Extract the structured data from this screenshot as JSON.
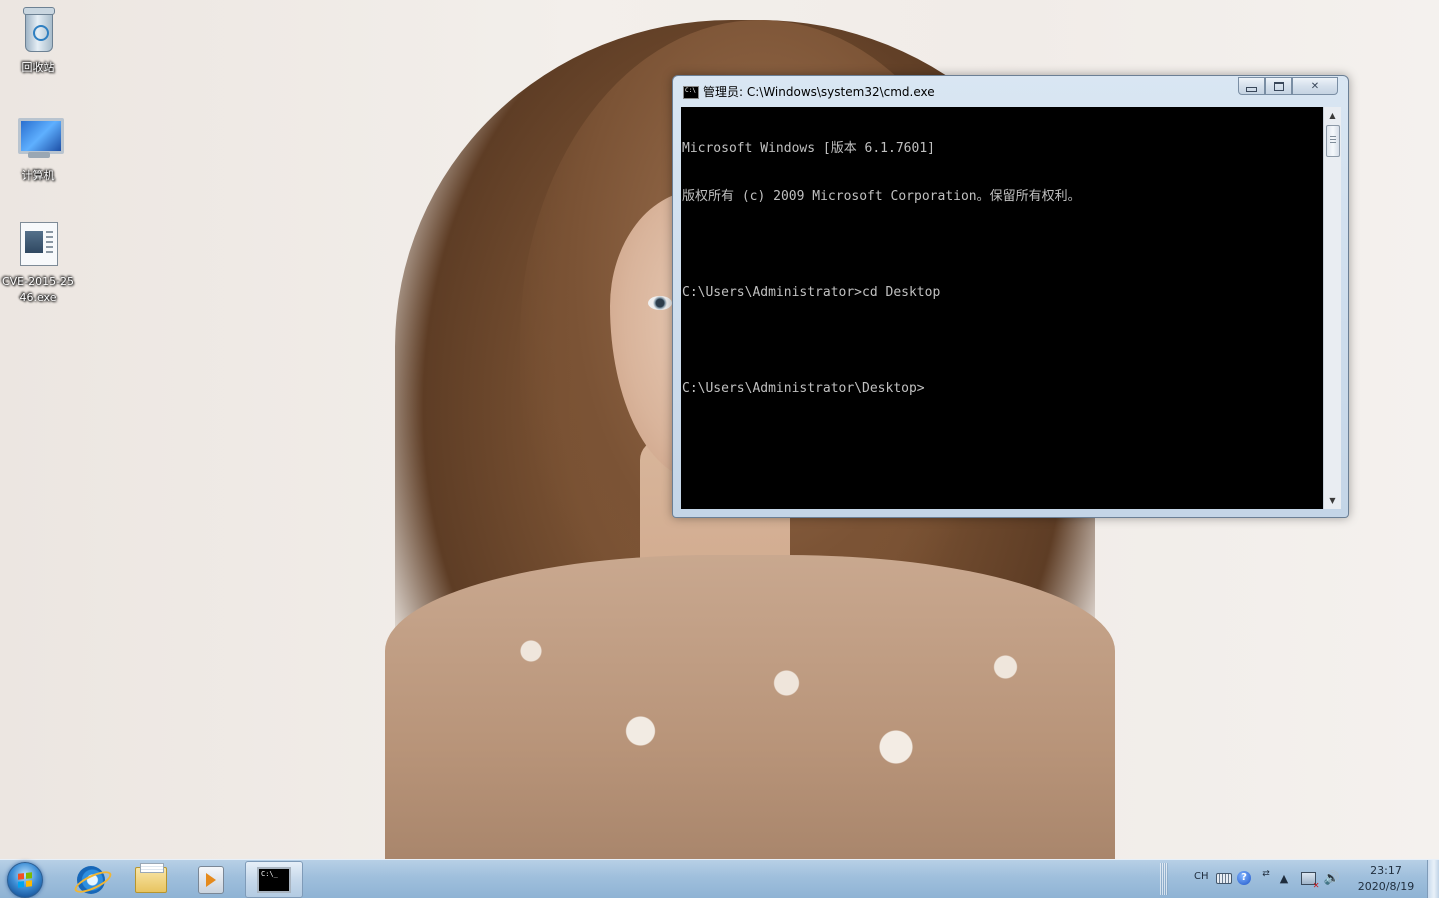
{
  "desktop": {
    "icons": [
      {
        "label": "回收站"
      },
      {
        "label": "计算机"
      },
      {
        "label": "CVE-2015-2546.exe"
      }
    ]
  },
  "cmd_window": {
    "app_icon_text": "C:\\",
    "title": "管理员: C:\\Windows\\system32\\cmd.exe",
    "minimize_glyph": "▁",
    "maximize_glyph": "□",
    "close_glyph": "✕",
    "lines": [
      "Microsoft Windows [版本 6.1.7601]",
      "版权所有 (c) 2009 Microsoft Corporation。保留所有权利。",
      "",
      "C:\\Users\\Administrator>cd Desktop",
      "",
      "C:\\Users\\Administrator\\Desktop>"
    ],
    "console_bg": "#000000",
    "console_fg": "#c0c0c0",
    "scroll_up_glyph": "▲",
    "scroll_down_glyph": "▼"
  },
  "taskbar": {
    "cmd_icon_text": "C:\\_",
    "tray": {
      "language": "CH",
      "help_glyph": "?",
      "ime_glyph": "⇄",
      "show_hidden_glyph": "▲",
      "volume_glyph": "🔊",
      "time": "23:17",
      "date": "2020/8/19"
    }
  },
  "colors": {
    "taskbar": "#9fbfdc",
    "window_frame": "#c4d5e7",
    "desktop_bg": "#efeae6"
  }
}
